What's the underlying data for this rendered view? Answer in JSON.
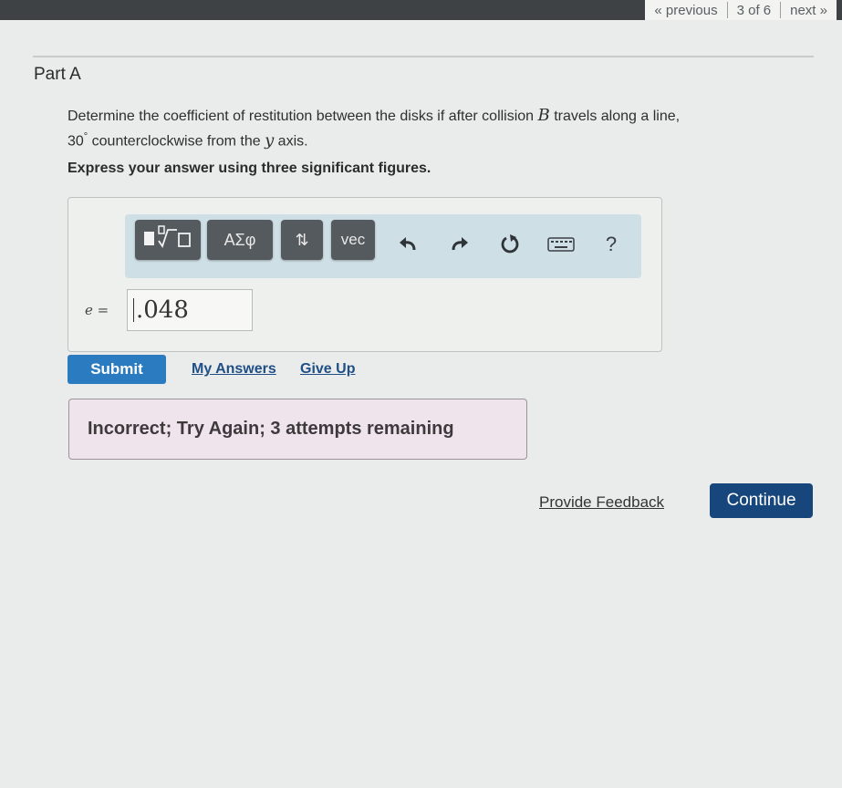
{
  "pager": {
    "previous_label": "« previous",
    "position": "3 of 6",
    "next_label": "next »"
  },
  "part": {
    "title": "Part A"
  },
  "question": {
    "text_before_var": "Determine the coefficient of restitution between the disks if after collision ",
    "var_b": "B",
    "text_after_var": " travels along a line,",
    "angle": "30",
    "degree_symbol": "°",
    "text_mid": " counterclockwise from the ",
    "var_y": "y",
    "text_end": " axis."
  },
  "instruction": "Express your answer using three significant figures.",
  "toolbar": {
    "templates_icon": "templates-icon",
    "greek_label": "ΑΣφ",
    "arrows_label": "⇅",
    "vec_label": "vec",
    "undo_icon": "undo-icon",
    "redo_icon": "redo-icon",
    "reset_icon": "reset-icon",
    "keyboard_icon": "keyboard-icon",
    "help_label": "?"
  },
  "answer": {
    "variable_label": "e =",
    "value": ".048"
  },
  "actions": {
    "submit_label": "Submit",
    "my_answers_label": "My Answers",
    "give_up_label": "Give Up"
  },
  "feedback": {
    "message": "Incorrect; Try Again; 3 attempts remaining"
  },
  "footer": {
    "provide_feedback_label": "Provide Feedback",
    "continue_label": "Continue"
  },
  "colors": {
    "submit": "#2a7bbf",
    "continue": "#17467c",
    "feedback_bg": "#efe4ec",
    "toolbar_bg": "#cfdfe6"
  }
}
